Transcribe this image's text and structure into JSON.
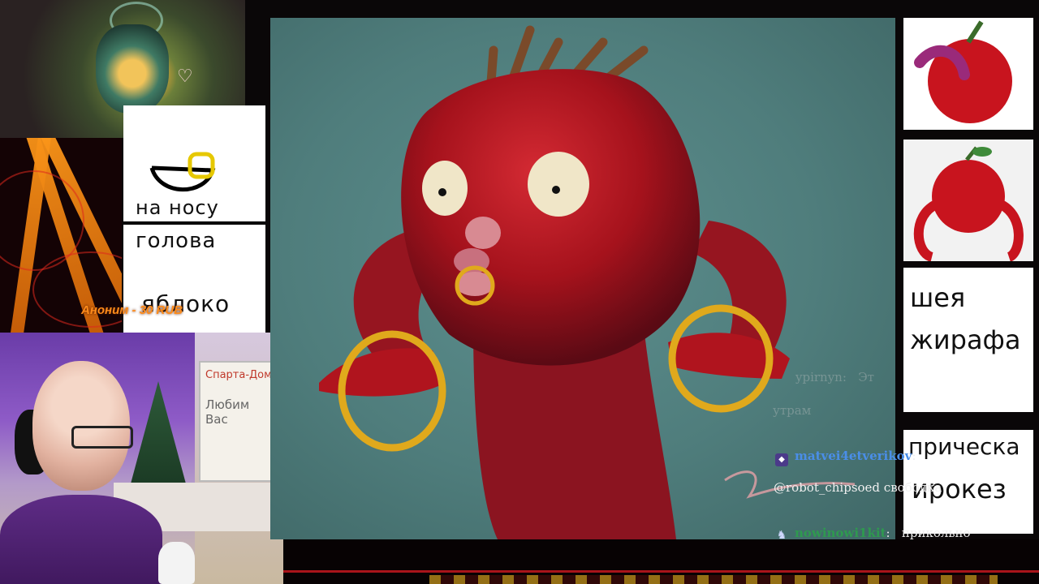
{
  "overlay_left": {
    "sheet_words": [
      "на носу",
      "голова",
      "яблоко"
    ],
    "donation_alert": "Аноним - 30 RUB"
  },
  "reference_right": {
    "words": [
      "шея",
      "жирафа",
      "прическа",
      "ирокез"
    ]
  },
  "webcam_board_text": [
    "Спарта-Дом",
    "Любим Вас"
  ],
  "chat": {
    "faded_message": {
      "user": "ypirnyn",
      "text": "Эт",
      "continuation": "утрам"
    },
    "messages": [
      {
        "user": "matvei4etverikov",
        "text": "",
        "user_color": "#4a8ee8",
        "icon": "badge-icon"
      },
      {
        "user": "",
        "text": "@robot_chipsoed свободка",
        "user_color": "",
        "icon": ""
      },
      {
        "user": "nowinowi1kit",
        "text": "прикольно",
        "user_color": "#2e9a4f",
        "icon": "bunny-icon"
      }
    ]
  },
  "colors": {
    "canvas_bg": "#4f7d7c",
    "creature_red": "#b0141e",
    "ring_gold": "#e0a91c",
    "donation": "#ff8c1a",
    "bottom_line": "#a8141a"
  }
}
